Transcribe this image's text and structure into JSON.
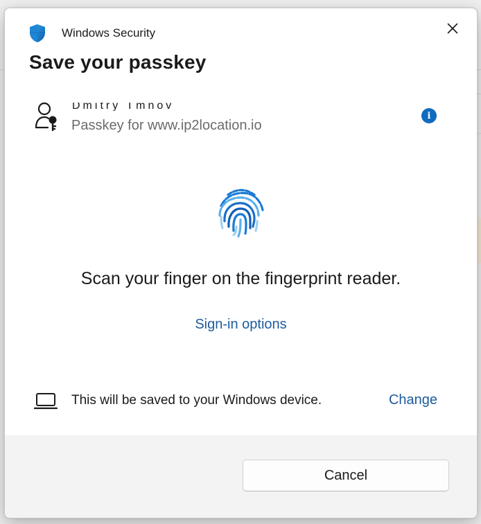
{
  "window": {
    "app_title": "Windows Security",
    "close_icon": "close-icon",
    "shield_icon": "windows-security-shield-icon"
  },
  "dialog": {
    "heading": "Save your passkey",
    "account": {
      "name": "Dmitry Tmnov",
      "subtitle": "Passkey for www.ip2location.io",
      "icon": "key-person-icon",
      "info_icon": "info-icon",
      "info_glyph": "i"
    },
    "prompt": {
      "icon": "fingerprint-icon",
      "instruction": "Scan your finger on the fingerprint reader.",
      "signin_options_label": "Sign-in options"
    },
    "device": {
      "icon": "laptop-icon",
      "text": "This will be saved to your Windows device.",
      "change_label": "Change"
    },
    "footer": {
      "cancel_label": "Cancel"
    }
  },
  "colors": {
    "accent": "#0f6cbd",
    "link": "#1c5b9e",
    "footer_bg": "#f3f3f3"
  }
}
